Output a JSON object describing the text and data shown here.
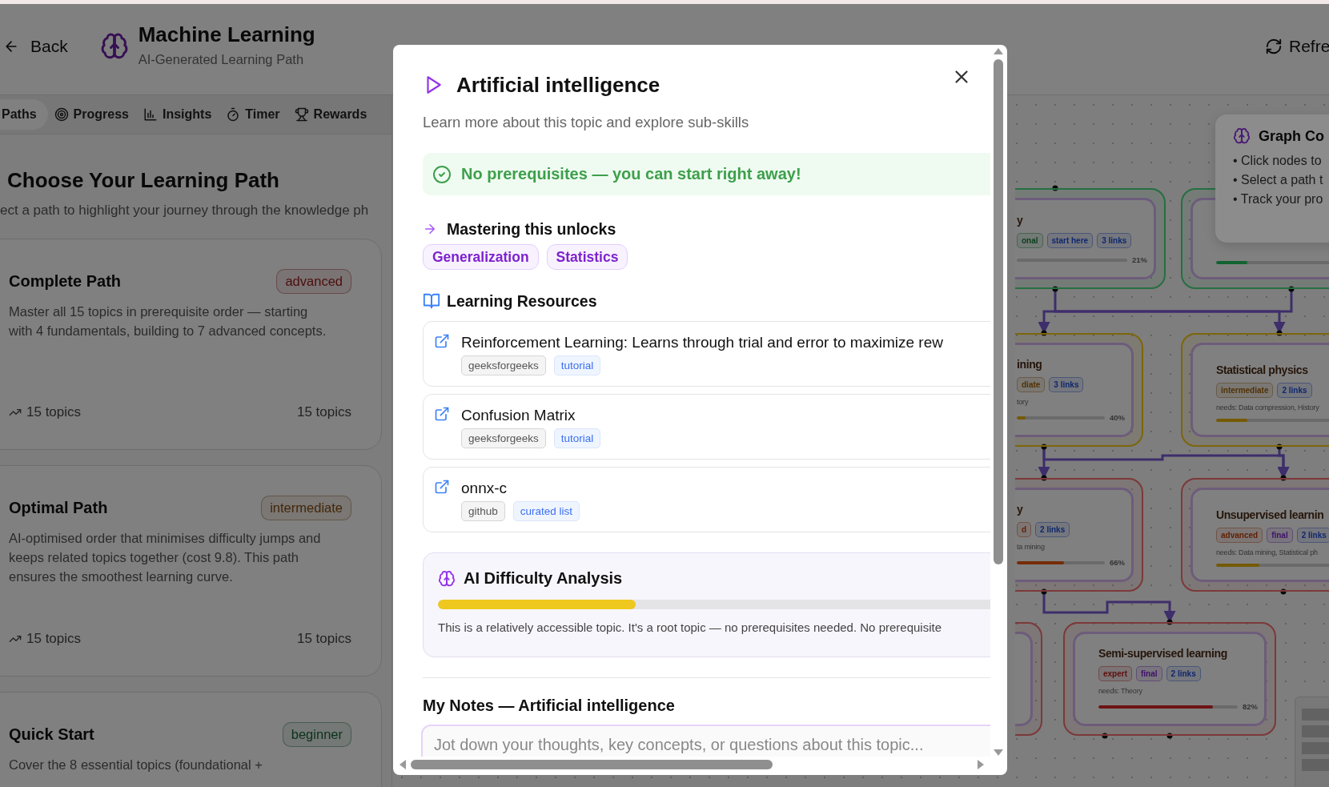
{
  "header": {
    "back": "Back",
    "title": "Machine Learning",
    "subtitle": "AI-Generated Learning Path",
    "refresh": "Refre"
  },
  "tabs": [
    {
      "label": "Paths",
      "selected": true
    },
    {
      "label": "Progress",
      "selected": false
    },
    {
      "label": "Insights",
      "selected": false
    },
    {
      "label": "Timer",
      "selected": false
    },
    {
      "label": "Rewards",
      "selected": false
    }
  ],
  "paths_panel": {
    "title": "Choose Your Learning Path",
    "description": "ect a path to highlight your journey through the knowledge ph",
    "paths": [
      {
        "name": "Complete Path",
        "difficulty": "advanced",
        "color": "#4c0d0d",
        "description": "Master all 15 topics in prerequisite order — starting with 4 fundamentals, building to 7 advanced concepts.",
        "topics": "15 topics",
        "count": "15 topics"
      },
      {
        "name": "Optimal Path",
        "difficulty": "intermediate",
        "color": "#422607",
        "description": "AI-optimised order that minimises difficulty jumps and keeps related topics together (cost 9.8). This path ensures the smoothest learning curve.",
        "topics": "15 topics",
        "count": "15 topics"
      },
      {
        "name": "Quick Start",
        "difficulty": "beginner",
        "color": "#0b321a",
        "description": "Cover the 8 essential topics (foundational +"
      }
    ]
  },
  "graph": {
    "nodes": [
      {
        "title": "y",
        "color": "#256f40",
        "tags": [
          {
            "label": "onal",
            "color": "#0b401f"
          },
          {
            "label": "start here",
            "color": "#0f276c"
          },
          {
            "label": "3 links",
            "color": "#0f276c"
          }
        ],
        "progress": {
          "label": "21%"
        }
      },
      {
        "color": "#256f40",
        "progress": {
          "level": 0.2,
          "color": "#116330"
        }
      },
      {
        "title": "ining",
        "color": "#7d660b",
        "tags": [
          {
            "label": "diate",
            "color": "#513104"
          },
          {
            "label": "3 links",
            "color": "#0f276c"
          }
        ],
        "needs": "tory",
        "progress": {
          "level": 0.1,
          "color": "#755a04",
          "label": "40%"
        }
      },
      {
        "title": "Statistical physics",
        "color": "#7d660b",
        "tags": [
          {
            "label": "intermediate",
            "color": "#513104"
          },
          {
            "label": "2 links",
            "color": "#0f276c"
          }
        ],
        "needs": "needs: Data compression, History",
        "progress": {
          "level": 0.2,
          "color": "#755a04"
        }
      },
      {
        "title": "y",
        "color": "#7c3939",
        "tags": [
          {
            "label": "d",
            "color": "#612106"
          },
          {
            "label": "2 links",
            "color": "#0f276c"
          }
        ],
        "needs": "ta mining",
        "progress": {
          "level": 0.54,
          "color": "#752c06",
          "label": "66%"
        }
      },
      {
        "title": "Unsupervised learnin",
        "color": "#7c3939",
        "tags": [
          {
            "label": "advanced",
            "color": "#612106"
          },
          {
            "label": "final",
            "color": "#3f1167"
          },
          {
            "label": "2 links",
            "color": "#0f276c"
          }
        ],
        "needs": "needs: Data mining, Statistical ph",
        "progress": {
          "level": 0.28,
          "color": "#755a04"
        }
      },
      {
        "color": "#7c3939"
      },
      {
        "title": "Semi-supervised learning",
        "color": "#7c3939",
        "tags": [
          {
            "label": "expert",
            "color": "#5d0e0e"
          },
          {
            "label": "final",
            "color": "#3f1167"
          },
          {
            "label": "2 links",
            "color": "#0f276c"
          }
        ],
        "needs": "needs: Theory",
        "progress": {
          "level": 0.82,
          "color": "#6e1313",
          "label": "82%"
        }
      }
    ],
    "controls": {
      "title": "Graph Co",
      "tips": [
        "• Click nodes to",
        "• Select a path t",
        "• Track your pro"
      ]
    }
  },
  "modal": {
    "title": "Artificial intelligence",
    "subtitle": "Learn more about this topic and explore sub-skills",
    "prerequisites": "No prerequisites — you can start right away!",
    "unlocks": {
      "heading": "Mastering this unlocks",
      "topics": [
        "Generalization",
        "Statistics"
      ]
    },
    "resources": {
      "heading": "Learning Resources",
      "items": [
        {
          "title": "Reinforcement Learning: Learns through trial and error to maximize rew",
          "source": "geeksforgeeks",
          "type": "tutorial"
        },
        {
          "title": "Confusion Matrix",
          "source": "geeksforgeeks",
          "type": "tutorial"
        },
        {
          "title": "onnx-c",
          "source": "github",
          "type": "curated list"
        }
      ]
    },
    "difficulty": {
      "heading": "AI Difficulty Analysis",
      "level": 0.26,
      "text": "This is a relatively accessible topic. It's a root topic — no prerequisites needed. No prerequisite"
    },
    "notes": {
      "heading": "My Notes — Artificial intelligence",
      "placeholder": "Jot down your thoughts, key concepts, or questions about this topic..."
    }
  }
}
